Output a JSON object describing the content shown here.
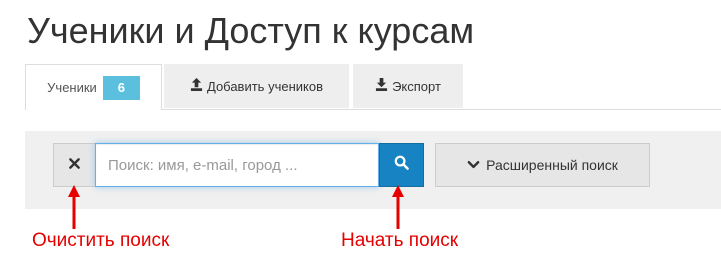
{
  "page": {
    "title": "Ученики и Доступ к курсам"
  },
  "tabs": [
    {
      "label": "Ученики",
      "badge": "6",
      "active": true
    },
    {
      "label": "Добавить учеников",
      "icon": "upload-icon"
    },
    {
      "label": "Экспорт",
      "icon": "download-icon"
    }
  ],
  "search": {
    "placeholder": "Поиск: имя, e-mail, город ...",
    "value": "",
    "clear_icon": "close-icon",
    "search_icon": "search-icon",
    "advanced_label": "Расширенный поиск",
    "advanced_icon": "chevron-down-icon"
  },
  "annotations": {
    "clear": "Очистить поиск",
    "start": "Начать поиск"
  },
  "colors": {
    "accent": "#1783c3",
    "badge": "#5bc0de",
    "annotation": "#e60000",
    "toolbar_bg": "#f0f0f0"
  }
}
